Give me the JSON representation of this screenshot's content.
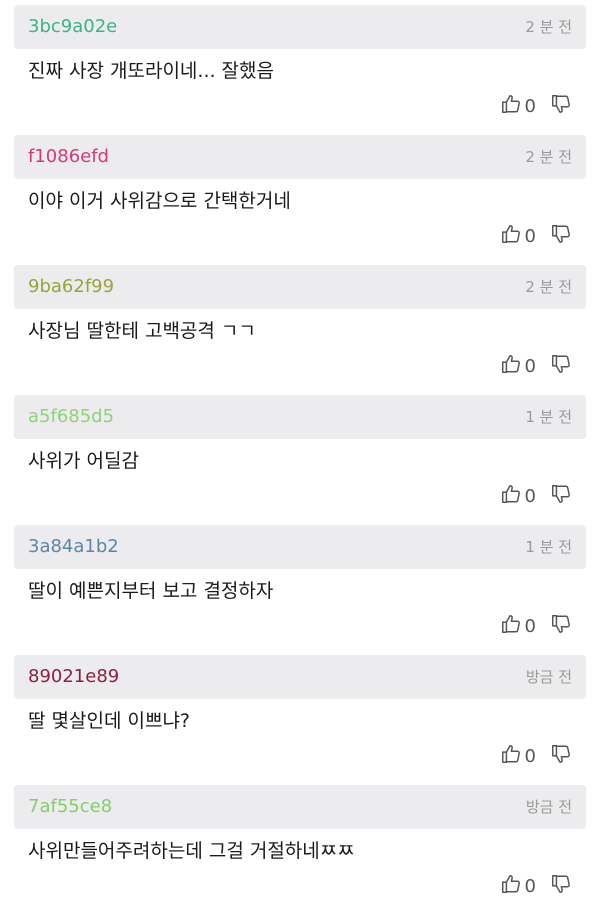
{
  "comments": [
    {
      "user": "3bc9a02e",
      "color": "#3bb38a",
      "time": "2 분 전",
      "text": "진짜 사장 개또라이네... 잘했음",
      "likes": "0"
    },
    {
      "user": "f1086efd",
      "color": "#d4397a",
      "time": "2 분 전",
      "text": "이야 이거 사위감으로 간택한거네",
      "likes": "0"
    },
    {
      "user": "9ba62f99",
      "color": "#9aa33a",
      "time": "2 분 전",
      "text": "사장님 딸한테 고백공격 ㄱㄱ",
      "likes": "0"
    },
    {
      "user": "a5f685d5",
      "color": "#8fd27a",
      "time": "1 분 전",
      "text": "사위가 어딜감",
      "likes": "0"
    },
    {
      "user": "3a84a1b2",
      "color": "#5b87a6",
      "time": "1 분 전",
      "text": "딸이 예쁜지부터 보고 결정하자",
      "likes": "0"
    },
    {
      "user": "89021e89",
      "color": "#8c2044",
      "time": "방금 전",
      "text": "딸 몇살인데 이쁘냐?",
      "likes": "0"
    },
    {
      "user": "7af55ce8",
      "color": "#84cf6b",
      "time": "방금 전",
      "text": "사위만들어주려하는데 그걸 거절하네ㅉㅉ",
      "likes": "0"
    }
  ]
}
